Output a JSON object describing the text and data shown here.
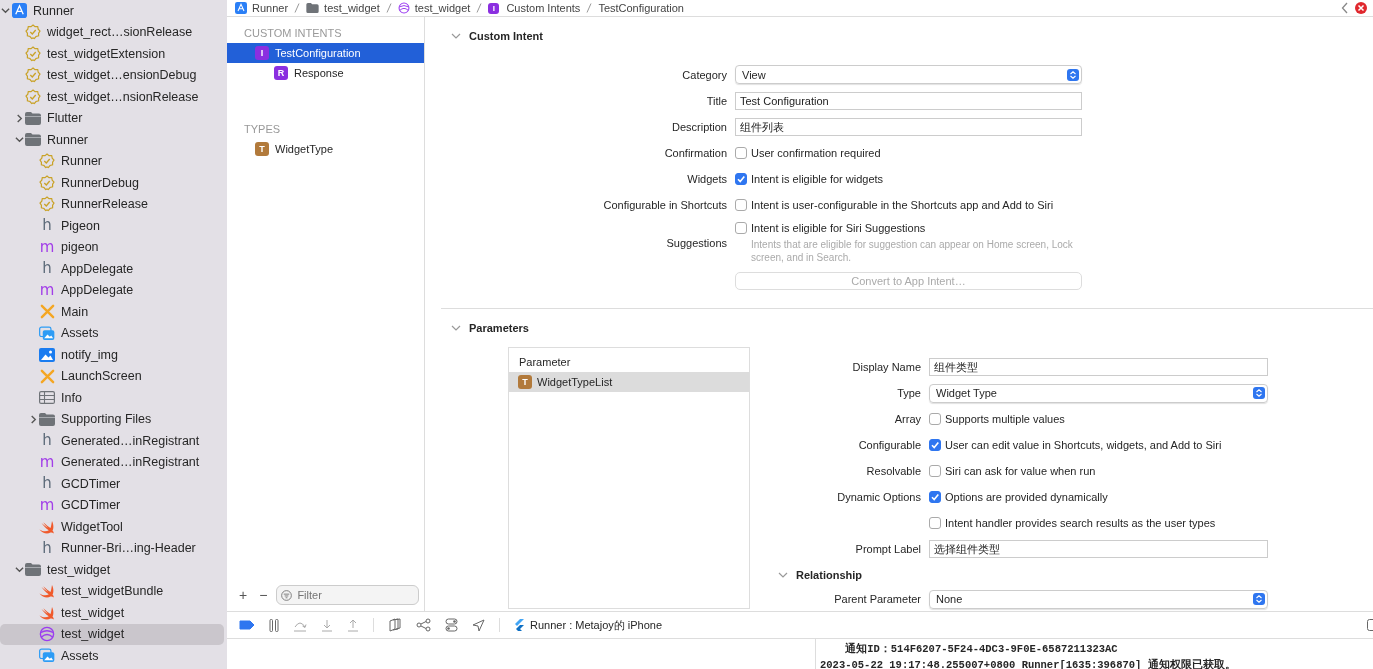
{
  "navigator": {
    "items": [
      {
        "label": "Runner",
        "kind": "project",
        "expanded": true,
        "selected": false,
        "children": [
          {
            "label": "widget_rect…sionRelease",
            "kind": "config",
            "selected": false
          },
          {
            "label": "test_widgetExtension",
            "kind": "config",
            "selected": false
          },
          {
            "label": "test_widget…ensionDebug",
            "kind": "config",
            "selected": false
          },
          {
            "label": "test_widget…nsionRelease",
            "kind": "config",
            "selected": false
          },
          {
            "label": "Flutter",
            "kind": "folder",
            "expanded": false,
            "selected": false
          },
          {
            "label": "Runner",
            "kind": "folder",
            "expanded": true,
            "selected": false,
            "children": [
              {
                "label": "Runner",
                "kind": "config",
                "selected": false
              },
              {
                "label": "RunnerDebug",
                "kind": "config",
                "selected": false
              },
              {
                "label": "RunnerRelease",
                "kind": "config",
                "selected": false
              },
              {
                "label": "Pigeon",
                "kind": "header",
                "glyph": "h",
                "selected": false
              },
              {
                "label": "pigeon",
                "kind": "objc",
                "glyph": "m",
                "selected": false
              },
              {
                "label": "AppDelegate",
                "kind": "header",
                "glyph": "h",
                "selected": false
              },
              {
                "label": "AppDelegate",
                "kind": "objc",
                "glyph": "m",
                "selected": false
              },
              {
                "label": "Main",
                "kind": "xib",
                "selected": false
              },
              {
                "label": "Assets",
                "kind": "assets",
                "selected": false
              },
              {
                "label": "notify_img",
                "kind": "image",
                "selected": false
              },
              {
                "label": "LaunchScreen",
                "kind": "xib",
                "selected": false
              },
              {
                "label": "Info",
                "kind": "plist",
                "selected": false
              },
              {
                "label": "Supporting Files",
                "kind": "folder",
                "expanded": false,
                "selected": false
              },
              {
                "label": "Generated…inRegistrant",
                "kind": "header",
                "glyph": "h",
                "selected": false
              },
              {
                "label": "Generated…inRegistrant",
                "kind": "objc",
                "glyph": "m",
                "selected": false
              },
              {
                "label": "GCDTimer",
                "kind": "header",
                "glyph": "h",
                "selected": false
              },
              {
                "label": "GCDTimer",
                "kind": "objc",
                "glyph": "m",
                "selected": false
              },
              {
                "label": "WidgetTool",
                "kind": "swift",
                "selected": false
              },
              {
                "label": "Runner-Bri…ing-Header",
                "kind": "header",
                "glyph": "h",
                "selected": false
              }
            ]
          },
          {
            "label": "test_widget",
            "kind": "folder",
            "expanded": true,
            "selected": false,
            "children": [
              {
                "label": "test_widgetBundle",
                "kind": "swift",
                "selected": false
              },
              {
                "label": "test_widget",
                "kind": "swift",
                "selected": false
              },
              {
                "label": "test_widget",
                "kind": "intents",
                "selected": true
              },
              {
                "label": "Assets",
                "kind": "assets",
                "selected": false
              }
            ]
          }
        ]
      }
    ]
  },
  "breadcrumb": [
    {
      "label": "Runner",
      "kind": "project"
    },
    {
      "label": "test_widget",
      "kind": "folder"
    },
    {
      "label": "test_widget",
      "kind": "intents"
    },
    {
      "label": "Custom Intents",
      "kind": "badge",
      "badge": "I"
    },
    {
      "label": "TestConfiguration",
      "kind": "plain"
    }
  ],
  "intent_list": {
    "sections": [
      {
        "title": "CUSTOM INTENTS",
        "items": [
          {
            "label": "TestConfiguration",
            "badge": "I",
            "kind": "intent",
            "selected": true,
            "children": [
              {
                "label": "Response",
                "badge": "R",
                "kind": "response",
                "selected": false
              }
            ]
          }
        ]
      },
      {
        "title": "TYPES",
        "items": [
          {
            "label": "WidgetType",
            "badge": "T",
            "kind": "type",
            "selected": false
          }
        ]
      }
    ],
    "add": "+",
    "remove": "−",
    "filter": {
      "placeholder": "Filter"
    }
  },
  "custom_intent": {
    "title": "Custom Intent",
    "expanded": true,
    "fields": [
      {
        "kind": "select",
        "label": "Category",
        "value": "View"
      },
      {
        "kind": "text",
        "label": "Title",
        "value": "Test Configuration"
      },
      {
        "kind": "text",
        "label": "Description",
        "value": "组件列表"
      },
      {
        "kind": "checkbox",
        "label": "Confirmation",
        "text": "User confirmation required",
        "checked": false
      },
      {
        "kind": "checkbox",
        "label": "Widgets",
        "text": "Intent is eligible for widgets",
        "checked": true
      },
      {
        "kind": "checkbox",
        "label": "Configurable in Shortcuts",
        "text": "Intent is user-configurable in the Shortcuts app and Add to Siri",
        "checked": false
      },
      {
        "kind": "checkbox",
        "label": "Suggestions",
        "text": "Intent is eligible for Siri Suggestions",
        "checked": false,
        "hint": "Intents that are eligible for suggestion can appear on Home screen, Lock screen, and in Search."
      },
      {
        "kind": "button",
        "label": "Convert to App Intent…",
        "disabled": true
      }
    ]
  },
  "parameters": {
    "title": "Parameters",
    "expanded": true,
    "table": {
      "header": "Parameter",
      "rows": [
        {
          "label": "WidgetTypeList",
          "badge": "T",
          "selected": true
        }
      ]
    },
    "fields": [
      {
        "kind": "text",
        "label": "Display Name",
        "value": "组件类型"
      },
      {
        "kind": "select",
        "label": "Type",
        "value": "Widget Type"
      },
      {
        "kind": "checkbox",
        "label": "Array",
        "text": "Supports multiple values",
        "checked": false
      },
      {
        "kind": "checkbox",
        "label": "Configurable",
        "text": "User can edit value in Shortcuts, widgets, and Add to Siri",
        "checked": true
      },
      {
        "kind": "checkbox",
        "label": "Resolvable",
        "text": "Siri can ask for value when run",
        "checked": false
      },
      {
        "kind": "checkbox",
        "label": "Dynamic Options",
        "text": "Options are provided dynamically",
        "checked": true
      },
      {
        "kind": "checkbox",
        "text": "Intent handler provides search results as the user types",
        "checked": false
      },
      {
        "kind": "text",
        "label": "Prompt Label",
        "value": "选择组件类型"
      }
    ],
    "relationship": {
      "title": "Relationship",
      "expanded": true,
      "fields": [
        {
          "kind": "select",
          "label": "Parent Parameter",
          "value": "None"
        }
      ]
    }
  },
  "debug_bar": {
    "tools": [
      {
        "kind": "breakpoint",
        "on": true
      },
      {
        "kind": "pause"
      },
      {
        "kind": "step-over"
      },
      {
        "kind": "step-in"
      },
      {
        "kind": "step-out"
      },
      {
        "kind": "views"
      },
      {
        "kind": "memory"
      },
      {
        "kind": "environment"
      },
      {
        "kind": "location"
      }
    ],
    "target": "Runner : Metajoy的 iPhone"
  },
  "console": {
    "lines": [
      "    通知ID：514F6207-5F24-4DC3-9F0E-6587211323AC",
      "2023-05-22 19:17:48.255007+0800 Runner[1635:396870] 通知权限已获取。"
    ]
  }
}
